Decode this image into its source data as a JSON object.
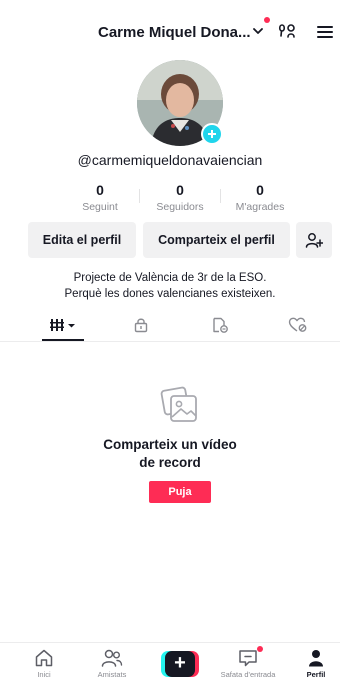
{
  "header": {
    "account_name": "Carme Miquel Dona...",
    "icons": {
      "dropdown": "chevron-down-icon",
      "creator": "creator-tools-icon",
      "menu": "hamburger-menu-icon"
    },
    "has_notification": true
  },
  "profile": {
    "username": "@carmemiqueldonavaiencian",
    "stats": [
      {
        "value": "0",
        "label": "Seguint"
      },
      {
        "value": "0",
        "label": "Seguidors"
      },
      {
        "value": "0",
        "label": "M'agrades"
      }
    ],
    "buttons": {
      "edit_label": "Edita el perfil",
      "share_label": "Comparteix el perfil",
      "add_friends_icon": "add-friend-icon"
    },
    "bio_line1": "Projecte de València de 3r de la ESO.",
    "bio_line2": "Perquè les dones valencianes existeixen."
  },
  "tabs": [
    {
      "icon": "videos-grid-icon",
      "active": true
    },
    {
      "icon": "private-lock-icon",
      "active": false
    },
    {
      "icon": "reposts-icon",
      "active": false
    },
    {
      "icon": "liked-icon",
      "active": false
    }
  ],
  "empty_state": {
    "icon": "photo-icon",
    "title_line1": "Comparteix un vídeo",
    "title_line2": "de record",
    "upload_label": "Puja"
  },
  "bottom_nav": {
    "items": [
      {
        "label": "Inici",
        "icon": "home-icon"
      },
      {
        "label": "Amistats",
        "icon": "friends-icon"
      },
      {
        "label": "",
        "icon": "create-plus-icon"
      },
      {
        "label": "Safata d'entrada",
        "icon": "inbox-icon"
      },
      {
        "label": "Perfil",
        "icon": "profile-icon",
        "active": true
      }
    ]
  },
  "colors": {
    "accent": "#fe2c55",
    "cyan": "#25f4ee",
    "text": "#161823",
    "muted": "#8a8b91",
    "button_bg": "#f1f1f2"
  }
}
